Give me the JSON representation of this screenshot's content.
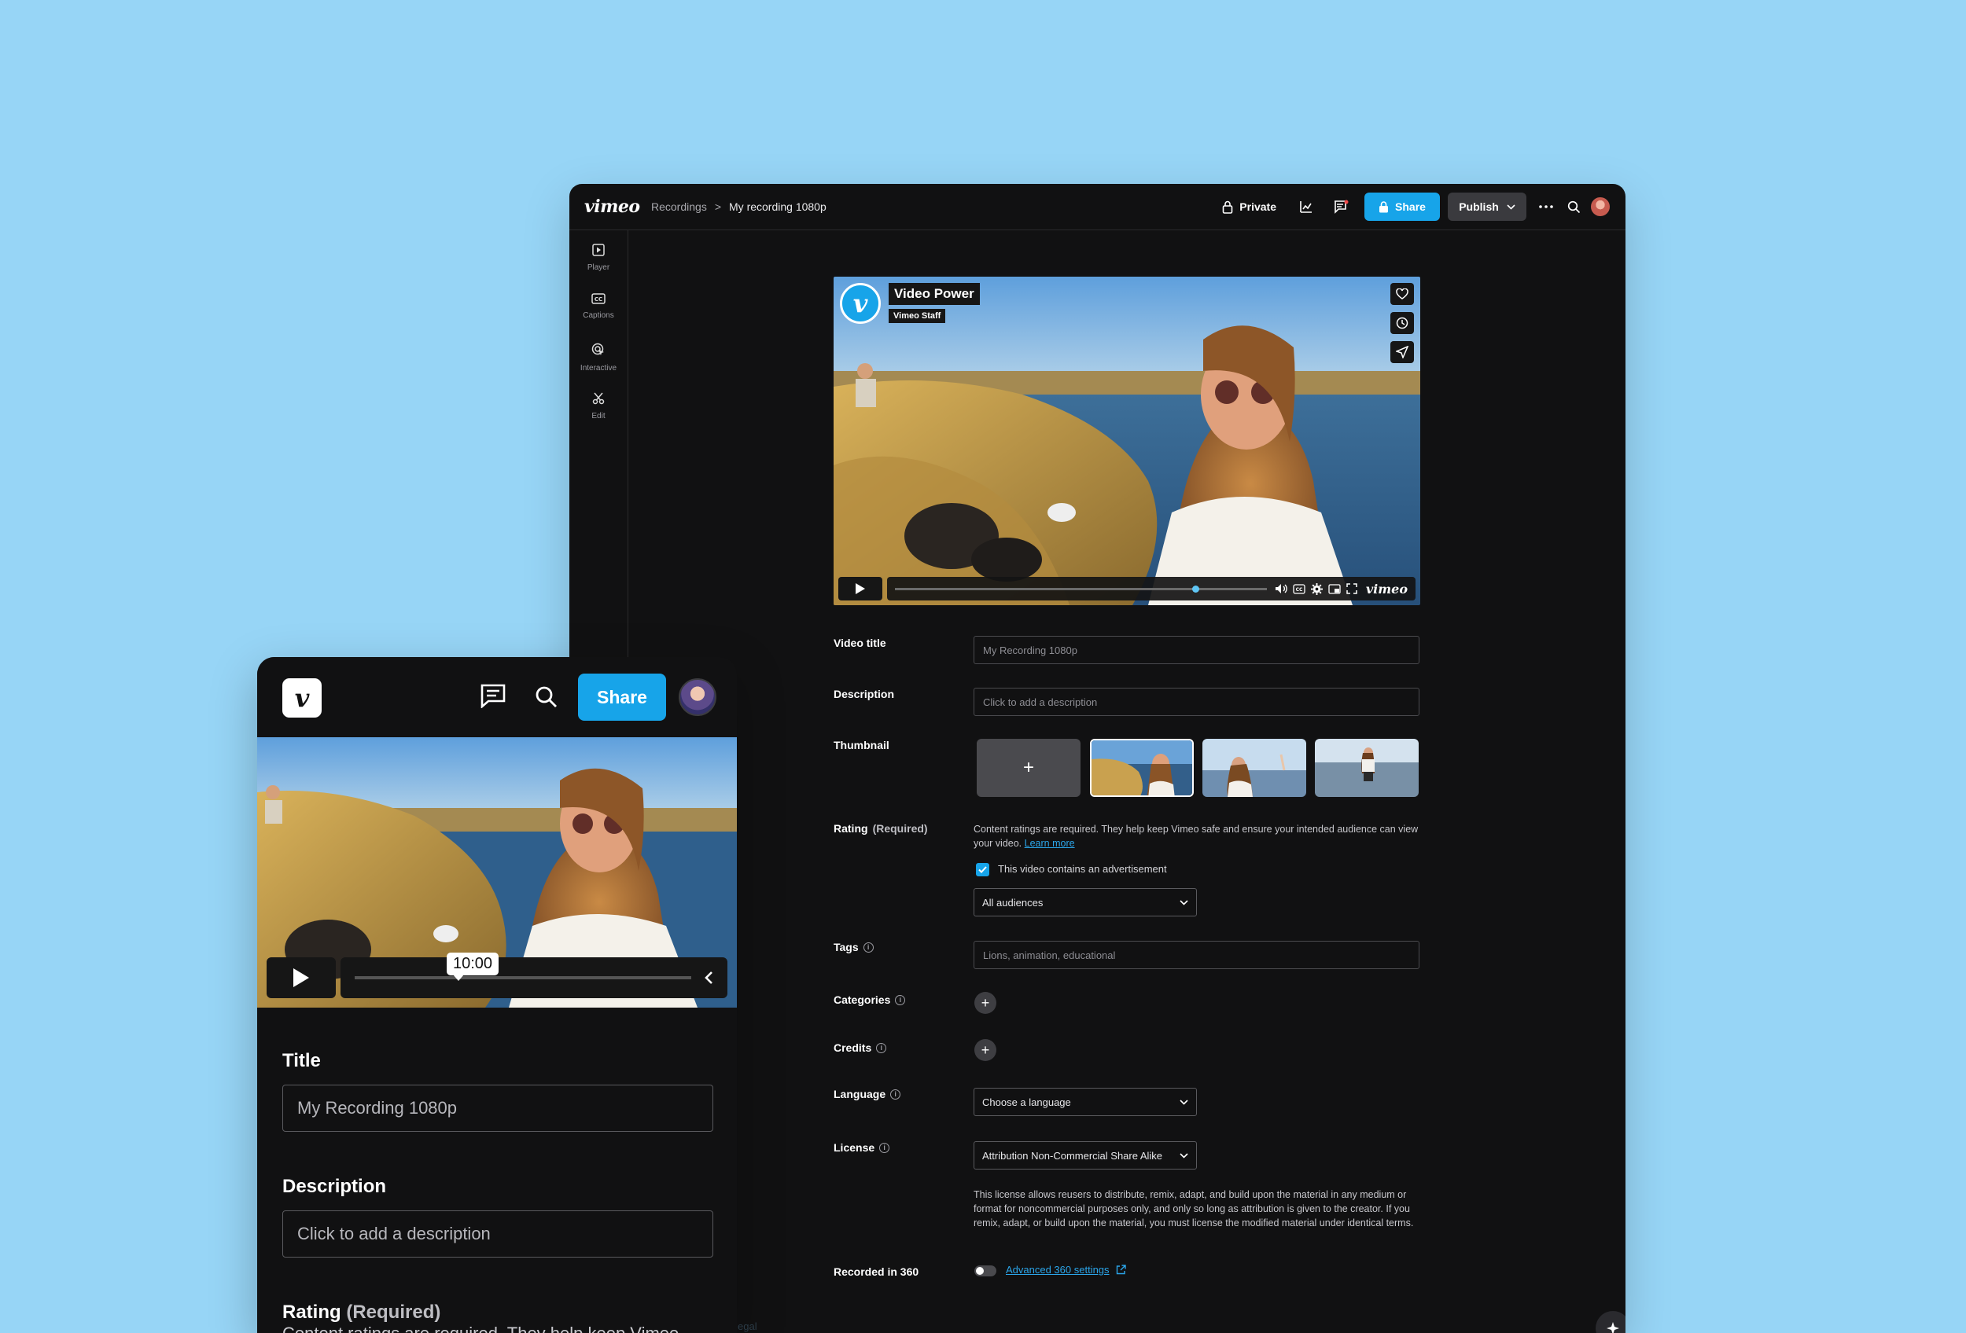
{
  "desktop": {
    "logo": "vimeo",
    "breadcrumb": {
      "parent": "Recordings",
      "separator": ">",
      "current": "My recording 1080p"
    },
    "header": {
      "privacy_label": "Private",
      "share_label": "Share",
      "publish_label": "Publish"
    },
    "sidebar": [
      {
        "label": "Player",
        "icon": "play-square-icon"
      },
      {
        "label": "Captions",
        "icon": "cc-icon"
      },
      {
        "label": "Interactive",
        "icon": "interactive-icon"
      },
      {
        "label": "Edit",
        "icon": "scissors-icon"
      }
    ],
    "player": {
      "channel_title": "Video Power",
      "channel_badge": "Vimeo Staff",
      "brand": "vimeo",
      "progress_fraction": 0.8
    },
    "form": {
      "video_title_label": "Video title",
      "video_title_value": "My Recording 1080p",
      "description_label": "Description",
      "description_placeholder": "Click to add a description",
      "thumbnail_label": "Thumbnail",
      "thumbnail_add": "+",
      "rating_label": "Rating",
      "rating_required": "(Required)",
      "rating_help": "Content ratings are required. They help keep Vimeo safe and ensure your intended audience can view your video.",
      "rating_learn_more": "Learn more",
      "advertisement_label": "This video contains an advertisement",
      "advertisement_checked": true,
      "audience_value": "All audiences",
      "tags_label": "Tags",
      "tags_placeholder": "Lions, animation, educational",
      "categories_label": "Categories",
      "credits_label": "Credits",
      "language_label": "Language",
      "language_value": "Choose a language",
      "license_label": "License",
      "license_value": "Attribution Non-Commercial Share Alike",
      "license_help": "This license allows reusers to distribute, remix, adapt, and build upon the material in any medium or format for noncommercial purposes only, and only so long as attribution is given to the creator. If you remix, adapt, or build upon the material, you must license the modified material under identical terms.",
      "recorded360_label": "Recorded in 360",
      "recorded360_on": false,
      "advanced360_link": "Advanced 360 settings"
    }
  },
  "mobile": {
    "share_label": "Share",
    "player_time": "10:00",
    "title_label": "Title",
    "title_value": "My Recording 1080p",
    "description_label": "Description",
    "description_placeholder": "Click to add a description",
    "rating_label": "Rating",
    "rating_required": "(Required)",
    "rating_help": "Content ratings are required. They help keep Vimeo",
    "legal_text": "egal"
  },
  "colors": {
    "background": "#97d5f6",
    "accent": "#17a4e9",
    "panel": "#111112"
  }
}
